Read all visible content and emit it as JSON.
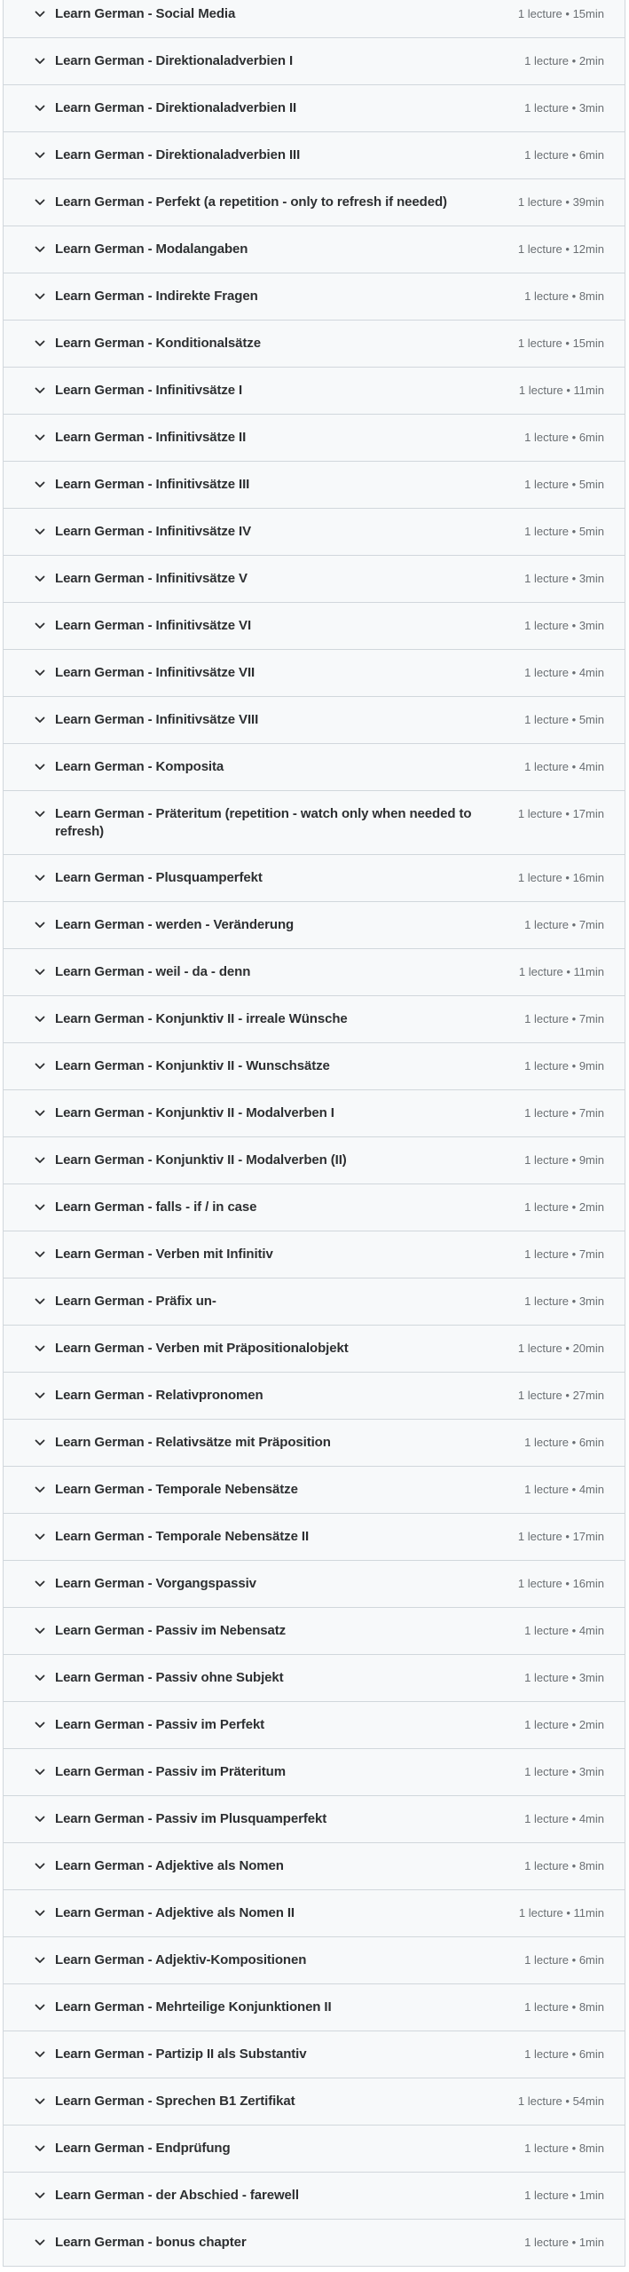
{
  "curriculum": {
    "meta_separator": " • ",
    "sections": [
      {
        "title": "Learn German - Social Media",
        "lectures": "1 lecture",
        "duration": "15min"
      },
      {
        "title": "Learn German - Direktionaladverbien I",
        "lectures": "1 lecture",
        "duration": "2min"
      },
      {
        "title": "Learn German - Direktionaladverbien II",
        "lectures": "1 lecture",
        "duration": "3min"
      },
      {
        "title": "Learn German - Direktionaladverbien III",
        "lectures": "1 lecture",
        "duration": "6min"
      },
      {
        "title": "Learn German - Perfekt (a repetition - only to refresh if needed)",
        "lectures": "1 lecture",
        "duration": "39min"
      },
      {
        "title": "Learn German - Modalangaben",
        "lectures": "1 lecture",
        "duration": "12min"
      },
      {
        "title": "Learn German - Indirekte Fragen",
        "lectures": "1 lecture",
        "duration": "8min"
      },
      {
        "title": "Learn German - Konditionalsätze",
        "lectures": "1 lecture",
        "duration": "15min"
      },
      {
        "title": "Learn German - Infinitivsätze I",
        "lectures": "1 lecture",
        "duration": "11min"
      },
      {
        "title": "Learn German - Infinitivsätze II",
        "lectures": "1 lecture",
        "duration": "6min"
      },
      {
        "title": "Learn German - Infinitivsätze III",
        "lectures": "1 lecture",
        "duration": "5min"
      },
      {
        "title": "Learn German - Infinitivsätze IV",
        "lectures": "1 lecture",
        "duration": "5min"
      },
      {
        "title": "Learn German - Infinitivsätze V",
        "lectures": "1 lecture",
        "duration": "3min"
      },
      {
        "title": "Learn German - Infinitivsätze VI",
        "lectures": "1 lecture",
        "duration": "3min"
      },
      {
        "title": "Learn German - Infinitivsätze VII",
        "lectures": "1 lecture",
        "duration": "4min"
      },
      {
        "title": "Learn German - Infinitivsätze VIII",
        "lectures": "1 lecture",
        "duration": "5min"
      },
      {
        "title": "Learn German - Komposita",
        "lectures": "1 lecture",
        "duration": "4min"
      },
      {
        "title": "Learn German - Präteritum (repetition - watch only when needed to refresh)",
        "lectures": "1 lecture",
        "duration": "17min"
      },
      {
        "title": "Learn German - Plusquamperfekt",
        "lectures": "1 lecture",
        "duration": "16min"
      },
      {
        "title": "Learn German - werden - Veränderung",
        "lectures": "1 lecture",
        "duration": "7min"
      },
      {
        "title": "Learn German - weil - da - denn",
        "lectures": "1 lecture",
        "duration": "11min"
      },
      {
        "title": "Learn German - Konjunktiv II - irreale Wünsche",
        "lectures": "1 lecture",
        "duration": "7min"
      },
      {
        "title": "Learn German - Konjunktiv II - Wunschsätze",
        "lectures": "1 lecture",
        "duration": "9min"
      },
      {
        "title": "Learn German - Konjunktiv II - Modalverben I",
        "lectures": "1 lecture",
        "duration": "7min"
      },
      {
        "title": "Learn German - Konjunktiv II - Modalverben (II)",
        "lectures": "1 lecture",
        "duration": "9min"
      },
      {
        "title": "Learn German - falls - if / in case",
        "lectures": "1 lecture",
        "duration": "2min"
      },
      {
        "title": "Learn German - Verben mit Infinitiv",
        "lectures": "1 lecture",
        "duration": "7min"
      },
      {
        "title": "Learn German - Präfix un-",
        "lectures": "1 lecture",
        "duration": "3min"
      },
      {
        "title": "Learn German - Verben mit Präpositionalobjekt",
        "lectures": "1 lecture",
        "duration": "20min"
      },
      {
        "title": "Learn German - Relativpronomen",
        "lectures": "1 lecture",
        "duration": "27min"
      },
      {
        "title": "Learn German - Relativsätze mit Präposition",
        "lectures": "1 lecture",
        "duration": "6min"
      },
      {
        "title": "Learn German - Temporale Nebensätze",
        "lectures": "1 lecture",
        "duration": "4min"
      },
      {
        "title": "Learn German - Temporale Nebensätze II",
        "lectures": "1 lecture",
        "duration": "17min"
      },
      {
        "title": "Learn German - Vorgangspassiv",
        "lectures": "1 lecture",
        "duration": "16min"
      },
      {
        "title": "Learn German - Passiv im Nebensatz",
        "lectures": "1 lecture",
        "duration": "4min"
      },
      {
        "title": "Learn German - Passiv ohne Subjekt",
        "lectures": "1 lecture",
        "duration": "3min"
      },
      {
        "title": "Learn German - Passiv im Perfekt",
        "lectures": "1 lecture",
        "duration": "2min"
      },
      {
        "title": "Learn German - Passiv im Präteritum",
        "lectures": "1 lecture",
        "duration": "3min"
      },
      {
        "title": "Learn German - Passiv im Plusquamperfekt",
        "lectures": "1 lecture",
        "duration": "4min"
      },
      {
        "title": "Learn German - Adjektive als Nomen",
        "lectures": "1 lecture",
        "duration": "8min"
      },
      {
        "title": "Learn German - Adjektive als Nomen II",
        "lectures": "1 lecture",
        "duration": "11min"
      },
      {
        "title": "Learn German - Adjektiv-Kompositionen",
        "lectures": "1 lecture",
        "duration": "6min"
      },
      {
        "title": "Learn German - Mehrteilige Konjunktionen II",
        "lectures": "1 lecture",
        "duration": "8min"
      },
      {
        "title": "Learn German - Partizip II als Substantiv",
        "lectures": "1 lecture",
        "duration": "6min"
      },
      {
        "title": "Learn German - Sprechen B1 Zertifikat",
        "lectures": "1 lecture",
        "duration": "54min"
      },
      {
        "title": "Learn German - Endprüfung",
        "lectures": "1 lecture",
        "duration": "8min"
      },
      {
        "title": "Learn German - der Abschied - farewell",
        "lectures": "1 lecture",
        "duration": "1min"
      },
      {
        "title": "Learn German - bonus chapter",
        "lectures": "1 lecture",
        "duration": "1min"
      }
    ],
    "icon": "chevron-down-icon",
    "colors": {
      "background": "#f7f9fa",
      "border": "#d1d7dc",
      "title": "#2d2f31",
      "meta": "#6a6f73"
    }
  }
}
